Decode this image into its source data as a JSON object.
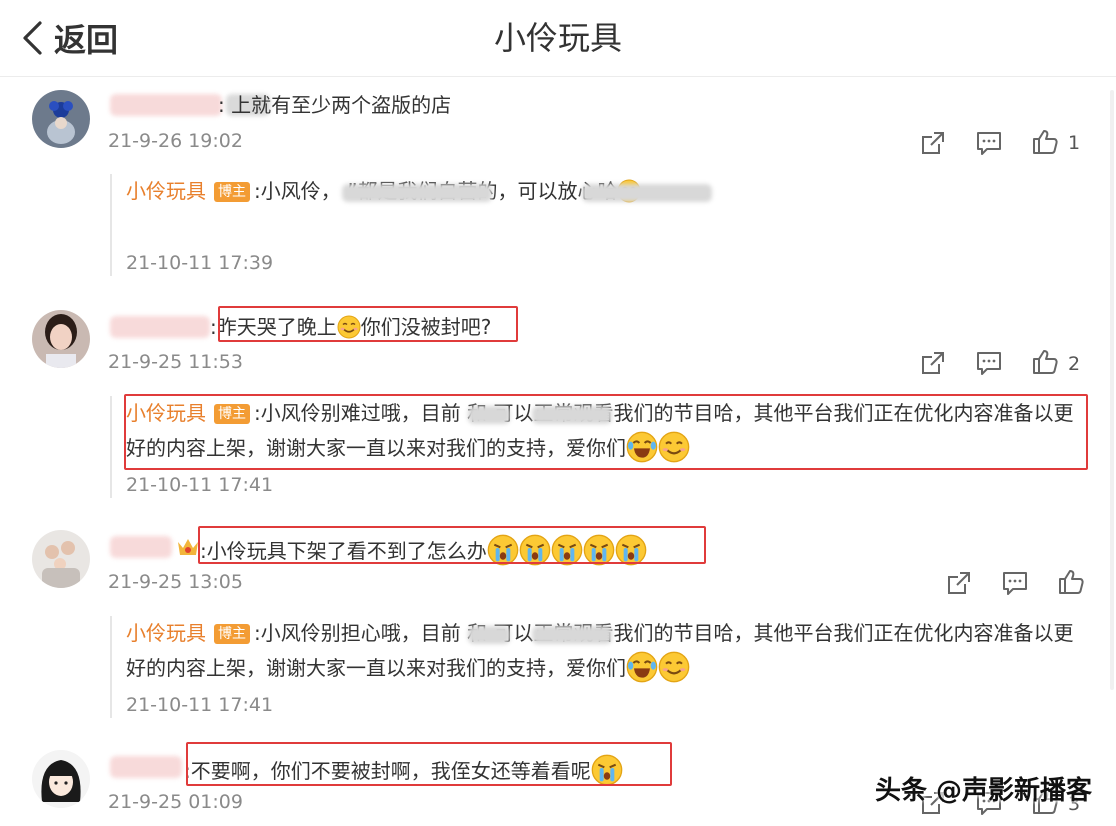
{
  "header": {
    "back_label": "返回",
    "title": "小伶玩具"
  },
  "reply_author": "小伶玩具",
  "badge_label": "博主",
  "comments": [
    {
      "text": ":        上就有至少两个盗版的店",
      "time": "21-9-26 19:02",
      "likes": "1",
      "reply": {
        "text": ":小风伶，                     ”都是我们自营的，可以放心哈",
        "time": "21-10-11 17:39"
      }
    },
    {
      "text": ":昨天哭了晚上",
      "text2": "你们没被封吧?",
      "time": "21-9-25 11:53",
      "likes": "2",
      "reply": {
        "text": ":小风伶别难过哦，目前     和      可以正常观看我们的节目哈，其他平台我们正在优化内容准备以更好的内容上架，谢谢大家一直以来对我们的支持，爱你们",
        "time": "21-10-11 17:41"
      }
    },
    {
      "text": ":小伶玩具下架了看不到了怎么办",
      "time": "21-9-25 13:05",
      "likes": "",
      "reply": {
        "text": ":小风伶别担心哦，目前     和      可以正常观看我们的节目哈，其他平台我们正在优化内容准备以更好的内容上架，谢谢大家一直以来对我们的支持，爱你们",
        "time": "21-10-11 17:41"
      }
    },
    {
      "text": ":不要啊，你们不要被封啊，我侄女还等着看呢",
      "time": "21-9-25 01:09",
      "likes": "3"
    }
  ],
  "watermark": "头条 @声影新播客",
  "icons": [
    "back-chevron-icon",
    "share-icon",
    "comment-icon",
    "like-icon",
    "smile-emoji",
    "cry-emoji",
    "laugh-cry-emoji",
    "crown-icon"
  ],
  "colors": {
    "accent": "#e8802d",
    "badge": "#f39c34",
    "highlight": "#e03b3b",
    "time": "#8a8a8a"
  }
}
